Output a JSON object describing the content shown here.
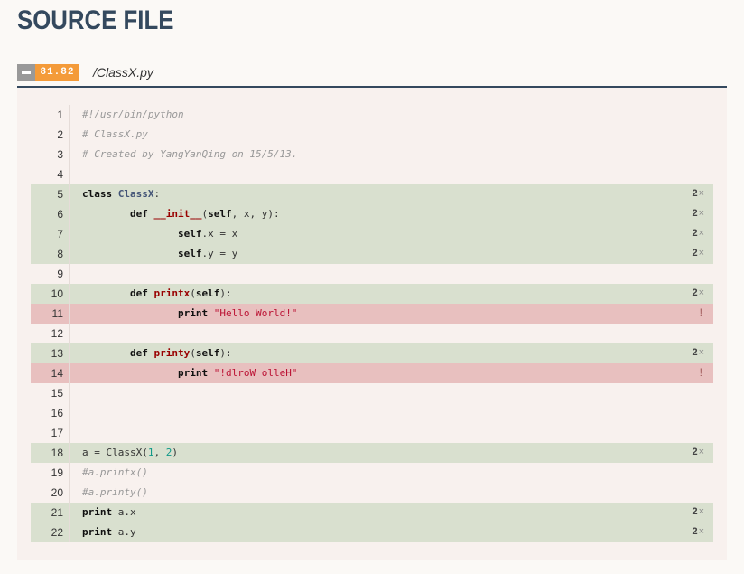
{
  "page": {
    "title": "SOURCE FILE"
  },
  "file": {
    "coverage": "81.82",
    "name": "/ClassX.py"
  },
  "colors": {
    "title": "#34495e",
    "coverage_badge": "#f49b39",
    "hit_row": "#d9e0cf",
    "miss_row": "#e8c0bf",
    "panel": "#f8f1ee"
  },
  "lines": [
    {
      "n": "1",
      "status": "none",
      "hits": "",
      "tokens": [
        {
          "t": "cm",
          "v": "#!/usr/bin/python"
        }
      ]
    },
    {
      "n": "2",
      "status": "none",
      "hits": "",
      "tokens": [
        {
          "t": "cm",
          "v": "# ClassX.py"
        }
      ]
    },
    {
      "n": "3",
      "status": "none",
      "hits": "",
      "tokens": [
        {
          "t": "cm",
          "v": "# Created by YangYanQing on 15/5/13."
        }
      ]
    },
    {
      "n": "4",
      "status": "none",
      "hits": "",
      "tokens": []
    },
    {
      "n": "5",
      "status": "hit",
      "hits": "2",
      "tokens": [
        {
          "t": "kw",
          "v": "class "
        },
        {
          "t": "cls",
          "v": "ClassX"
        },
        {
          "t": "",
          "v": ":"
        }
      ]
    },
    {
      "n": "6",
      "status": "hit",
      "hits": "2",
      "tokens": [
        {
          "t": "",
          "v": "        "
        },
        {
          "t": "kw",
          "v": "def "
        },
        {
          "t": "fn",
          "v": "__init__"
        },
        {
          "t": "",
          "v": "("
        },
        {
          "t": "kw",
          "v": "self"
        },
        {
          "t": "",
          "v": ", x, y):"
        }
      ]
    },
    {
      "n": "7",
      "status": "hit",
      "hits": "2",
      "tokens": [
        {
          "t": "",
          "v": "                "
        },
        {
          "t": "kw",
          "v": "self"
        },
        {
          "t": "",
          "v": ".x = x"
        }
      ]
    },
    {
      "n": "8",
      "status": "hit",
      "hits": "2",
      "tokens": [
        {
          "t": "",
          "v": "                "
        },
        {
          "t": "kw",
          "v": "self"
        },
        {
          "t": "",
          "v": ".y = y"
        }
      ]
    },
    {
      "n": "9",
      "status": "none",
      "hits": "",
      "tokens": []
    },
    {
      "n": "10",
      "status": "hit",
      "hits": "2",
      "tokens": [
        {
          "t": "",
          "v": "        "
        },
        {
          "t": "kw",
          "v": "def "
        },
        {
          "t": "fn",
          "v": "printx"
        },
        {
          "t": "",
          "v": "("
        },
        {
          "t": "kw",
          "v": "self"
        },
        {
          "t": "",
          "v": "):"
        }
      ]
    },
    {
      "n": "11",
      "status": "miss",
      "hits": "!",
      "tokens": [
        {
          "t": "",
          "v": "                "
        },
        {
          "t": "kw",
          "v": "print "
        },
        {
          "t": "str",
          "v": "\"Hello World!\""
        }
      ]
    },
    {
      "n": "12",
      "status": "none",
      "hits": "",
      "tokens": []
    },
    {
      "n": "13",
      "status": "hit",
      "hits": "2",
      "tokens": [
        {
          "t": "",
          "v": "        "
        },
        {
          "t": "kw",
          "v": "def "
        },
        {
          "t": "fn",
          "v": "printy"
        },
        {
          "t": "",
          "v": "("
        },
        {
          "t": "kw",
          "v": "self"
        },
        {
          "t": "",
          "v": "):"
        }
      ]
    },
    {
      "n": "14",
      "status": "miss",
      "hits": "!",
      "tokens": [
        {
          "t": "",
          "v": "                "
        },
        {
          "t": "kw",
          "v": "print "
        },
        {
          "t": "str",
          "v": "\"!dlroW olleH\""
        }
      ]
    },
    {
      "n": "15",
      "status": "none",
      "hits": "",
      "tokens": []
    },
    {
      "n": "16",
      "status": "none",
      "hits": "",
      "tokens": []
    },
    {
      "n": "17",
      "status": "none",
      "hits": "",
      "tokens": []
    },
    {
      "n": "18",
      "status": "hit",
      "hits": "2",
      "tokens": [
        {
          "t": "",
          "v": "a = ClassX("
        },
        {
          "t": "num",
          "v": "1"
        },
        {
          "t": "",
          "v": ", "
        },
        {
          "t": "num",
          "v": "2"
        },
        {
          "t": "",
          "v": ")"
        }
      ]
    },
    {
      "n": "19",
      "status": "none",
      "hits": "",
      "tokens": [
        {
          "t": "cm",
          "v": "#a.printx()"
        }
      ]
    },
    {
      "n": "20",
      "status": "none",
      "hits": "",
      "tokens": [
        {
          "t": "cm",
          "v": "#a.printy()"
        }
      ]
    },
    {
      "n": "21",
      "status": "hit",
      "hits": "2",
      "tokens": [
        {
          "t": "kw",
          "v": "print "
        },
        {
          "t": "",
          "v": "a.x"
        }
      ]
    },
    {
      "n": "22",
      "status": "hit",
      "hits": "2",
      "tokens": [
        {
          "t": "kw",
          "v": "print "
        },
        {
          "t": "",
          "v": "a.y"
        }
      ]
    }
  ]
}
